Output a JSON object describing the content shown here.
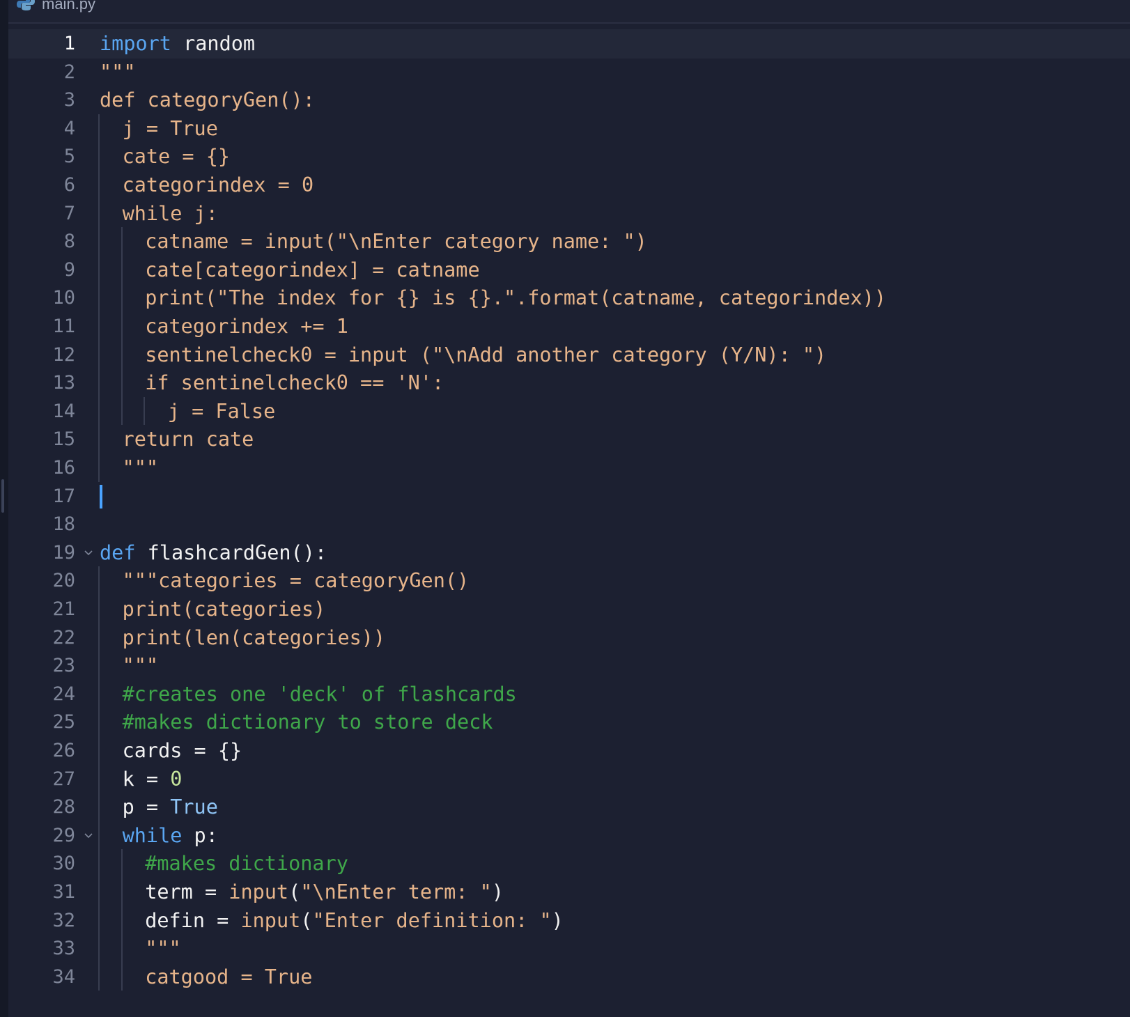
{
  "tab": {
    "filename": "main.py",
    "icon": "python-file-icon"
  },
  "editor": {
    "active_line": 1,
    "cursor_line": 17,
    "lines": [
      {
        "n": "1",
        "indent": 0,
        "segments": [
          {
            "t": "import",
            "c": "kw"
          },
          {
            "t": " random",
            "c": "wh"
          }
        ]
      },
      {
        "n": "2",
        "indent": 0,
        "segments": [
          {
            "t": "\"\"\"",
            "c": "str"
          }
        ]
      },
      {
        "n": "3",
        "indent": 0,
        "segments": [
          {
            "t": "def categoryGen():",
            "c": "str"
          }
        ]
      },
      {
        "n": "4",
        "indent": 1,
        "segments": [
          {
            "t": "j = True",
            "c": "str"
          }
        ]
      },
      {
        "n": "5",
        "indent": 1,
        "segments": [
          {
            "t": "cate = {}",
            "c": "str"
          }
        ]
      },
      {
        "n": "6",
        "indent": 1,
        "segments": [
          {
            "t": "categorindex = 0",
            "c": "str"
          }
        ]
      },
      {
        "n": "7",
        "indent": 1,
        "segments": [
          {
            "t": "while j:",
            "c": "str"
          }
        ]
      },
      {
        "n": "8",
        "indent": 2,
        "segments": [
          {
            "t": "catname = input(\"\\nEnter category name: \")",
            "c": "str"
          }
        ]
      },
      {
        "n": "9",
        "indent": 2,
        "segments": [
          {
            "t": "cate[categorindex] = catname",
            "c": "str"
          }
        ]
      },
      {
        "n": "10",
        "indent": 2,
        "segments": [
          {
            "t": "print(\"The index for {} is {}.\".format(catname, categorindex))",
            "c": "str"
          }
        ]
      },
      {
        "n": "11",
        "indent": 2,
        "segments": [
          {
            "t": "categorindex += 1",
            "c": "str"
          }
        ]
      },
      {
        "n": "12",
        "indent": 2,
        "segments": [
          {
            "t": "sentinelcheck0 = input (\"\\nAdd another category (Y/N): \")",
            "c": "str"
          }
        ]
      },
      {
        "n": "13",
        "indent": 2,
        "segments": [
          {
            "t": "if sentinelcheck0 == 'N':",
            "c": "str"
          }
        ]
      },
      {
        "n": "14",
        "indent": 3,
        "segments": [
          {
            "t": "j = False",
            "c": "str"
          }
        ]
      },
      {
        "n": "15",
        "indent": 1,
        "segments": [
          {
            "t": "return cate",
            "c": "str"
          }
        ]
      },
      {
        "n": "16",
        "indent": 1,
        "segments": [
          {
            "t": "\"\"\"",
            "c": "str"
          }
        ]
      },
      {
        "n": "17",
        "indent": 0,
        "segments": []
      },
      {
        "n": "18",
        "indent": 0,
        "segments": []
      },
      {
        "n": "19",
        "indent": 0,
        "fold": true,
        "segments": [
          {
            "t": "def",
            "c": "kw"
          },
          {
            "t": " flashcardGen():",
            "c": "wh"
          }
        ]
      },
      {
        "n": "20",
        "indent": 1,
        "segments": [
          {
            "t": "\"\"\"categories = categoryGen()",
            "c": "str"
          }
        ]
      },
      {
        "n": "21",
        "indent": 1,
        "segments": [
          {
            "t": "print(categories)",
            "c": "str"
          }
        ]
      },
      {
        "n": "22",
        "indent": 1,
        "segments": [
          {
            "t": "print(len(categories))",
            "c": "str"
          }
        ]
      },
      {
        "n": "23",
        "indent": 1,
        "segments": [
          {
            "t": "\"\"\"",
            "c": "str"
          }
        ]
      },
      {
        "n": "24",
        "indent": 1,
        "segments": [
          {
            "t": "#creates one 'deck' of flashcards",
            "c": "cm"
          }
        ]
      },
      {
        "n": "25",
        "indent": 1,
        "segments": [
          {
            "t": "#makes dictionary to store deck",
            "c": "cm"
          }
        ]
      },
      {
        "n": "26",
        "indent": 1,
        "segments": [
          {
            "t": "cards = {}",
            "c": "wh"
          }
        ]
      },
      {
        "n": "27",
        "indent": 1,
        "segments": [
          {
            "t": "k = ",
            "c": "wh"
          },
          {
            "t": "0",
            "c": "num"
          }
        ]
      },
      {
        "n": "28",
        "indent": 1,
        "segments": [
          {
            "t": "p = ",
            "c": "wh"
          },
          {
            "t": "True",
            "c": "tr"
          }
        ]
      },
      {
        "n": "29",
        "indent": 1,
        "fold": true,
        "segments": [
          {
            "t": "while",
            "c": "kw"
          },
          {
            "t": " p:",
            "c": "wh"
          }
        ]
      },
      {
        "n": "30",
        "indent": 2,
        "segments": [
          {
            "t": "#makes dictionary",
            "c": "cm"
          }
        ]
      },
      {
        "n": "31",
        "indent": 2,
        "segments": [
          {
            "t": "term = ",
            "c": "wh"
          },
          {
            "t": "input",
            "c": "str"
          },
          {
            "t": "(",
            "c": "wh"
          },
          {
            "t": "\"\\nEnter term: \"",
            "c": "str"
          },
          {
            "t": ")",
            "c": "wh"
          }
        ]
      },
      {
        "n": "32",
        "indent": 2,
        "segments": [
          {
            "t": "defin = ",
            "c": "wh"
          },
          {
            "t": "input",
            "c": "str"
          },
          {
            "t": "(",
            "c": "wh"
          },
          {
            "t": "\"Enter definition: \"",
            "c": "str"
          },
          {
            "t": ")",
            "c": "wh"
          }
        ]
      },
      {
        "n": "33",
        "indent": 2,
        "segments": [
          {
            "t": "\"\"\"",
            "c": "str"
          }
        ]
      },
      {
        "n": "34",
        "indent": 2,
        "segments": [
          {
            "t": "catgood = True",
            "c": "str"
          }
        ]
      }
    ]
  },
  "colors": {
    "background": "#1c2031",
    "string": "#e6b48a",
    "keyword": "#5aa6f2",
    "comment": "#3fa74a",
    "number": "#c6e59c",
    "boolean": "#8fc4f5",
    "cursor": "#4aa3ff"
  }
}
